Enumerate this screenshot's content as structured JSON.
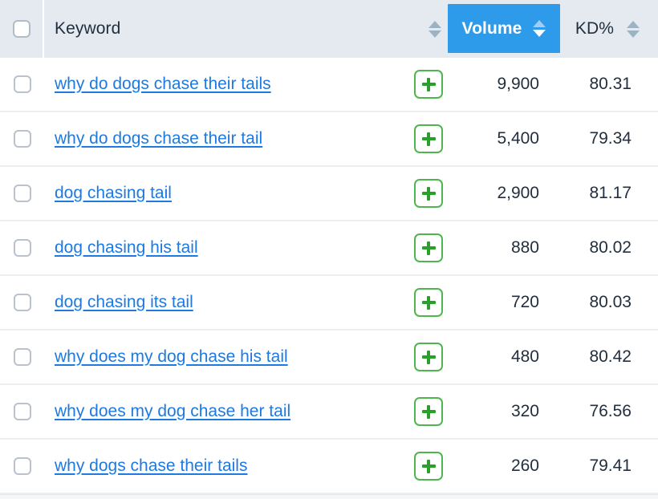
{
  "table": {
    "columns": {
      "select_all_name": "select-all-checkbox",
      "keyword_label": "Keyword",
      "volume_label": "Volume",
      "kd_label": "KD%"
    },
    "sort": {
      "active_column": "Volume",
      "direction": "descending"
    },
    "add_button_label": "+",
    "rows": [
      {
        "keyword": "why do dogs chase their tails",
        "volume": "9,900",
        "kd": "80.31"
      },
      {
        "keyword": "why do dogs chase their tail",
        "volume": "5,400",
        "kd": "79.34"
      },
      {
        "keyword": "dog chasing tail",
        "volume": "2,900",
        "kd": "81.17"
      },
      {
        "keyword": "dog chasing his tail",
        "volume": "880",
        "kd": "80.02"
      },
      {
        "keyword": "dog chasing its tail",
        "volume": "720",
        "kd": "80.03"
      },
      {
        "keyword": "why does my dog chase his tail",
        "volume": "480",
        "kd": "80.42"
      },
      {
        "keyword": "why does my dog chase her tail",
        "volume": "320",
        "kd": "76.56"
      },
      {
        "keyword": "why dogs chase their tails",
        "volume": "260",
        "kd": "79.41"
      }
    ]
  },
  "colors": {
    "header_bg": "#e4eaf0",
    "active_column_bg": "#2e9aea",
    "link": "#1e79e0",
    "add_green": "#4fb64f",
    "text": "#222f3e"
  }
}
